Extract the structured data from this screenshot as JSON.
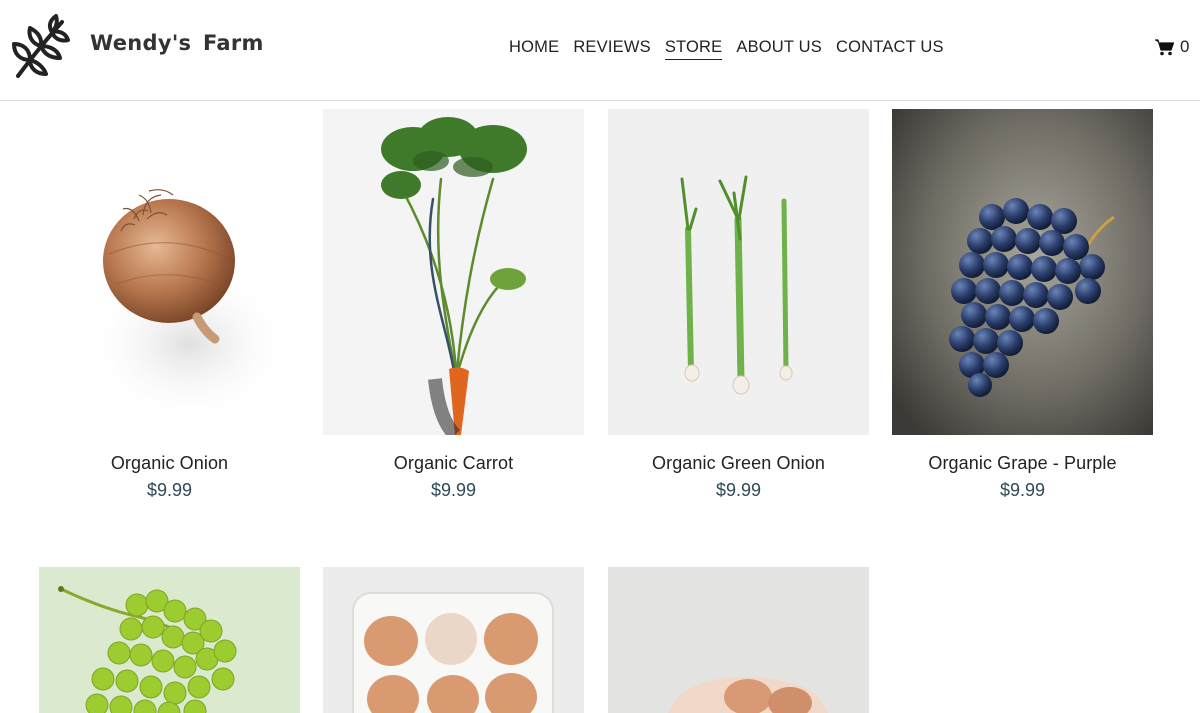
{
  "brand": {
    "name": "Wendy's  Farm",
    "logo_icon": "leaf-branch-icon"
  },
  "nav": {
    "items": [
      {
        "label": "HOME",
        "active": false
      },
      {
        "label": "REVIEWS",
        "active": false
      },
      {
        "label": "STORE",
        "active": true
      },
      {
        "label": "ABOUT US",
        "active": false
      },
      {
        "label": "CONTACT US",
        "active": false
      }
    ]
  },
  "cart": {
    "icon": "shopping-cart-icon",
    "count": "0"
  },
  "products": [
    {
      "title": "Organic Onion",
      "price": "$9.99"
    },
    {
      "title": "Organic Carrot",
      "price": "$9.99"
    },
    {
      "title": "Organic Green Onion",
      "price": "$9.99"
    },
    {
      "title": "Organic Grape - Purple",
      "price": "$9.99"
    }
  ],
  "colors": {
    "price": "#2e4a57",
    "text": "#222222",
    "divider": "#dcdcdc"
  }
}
